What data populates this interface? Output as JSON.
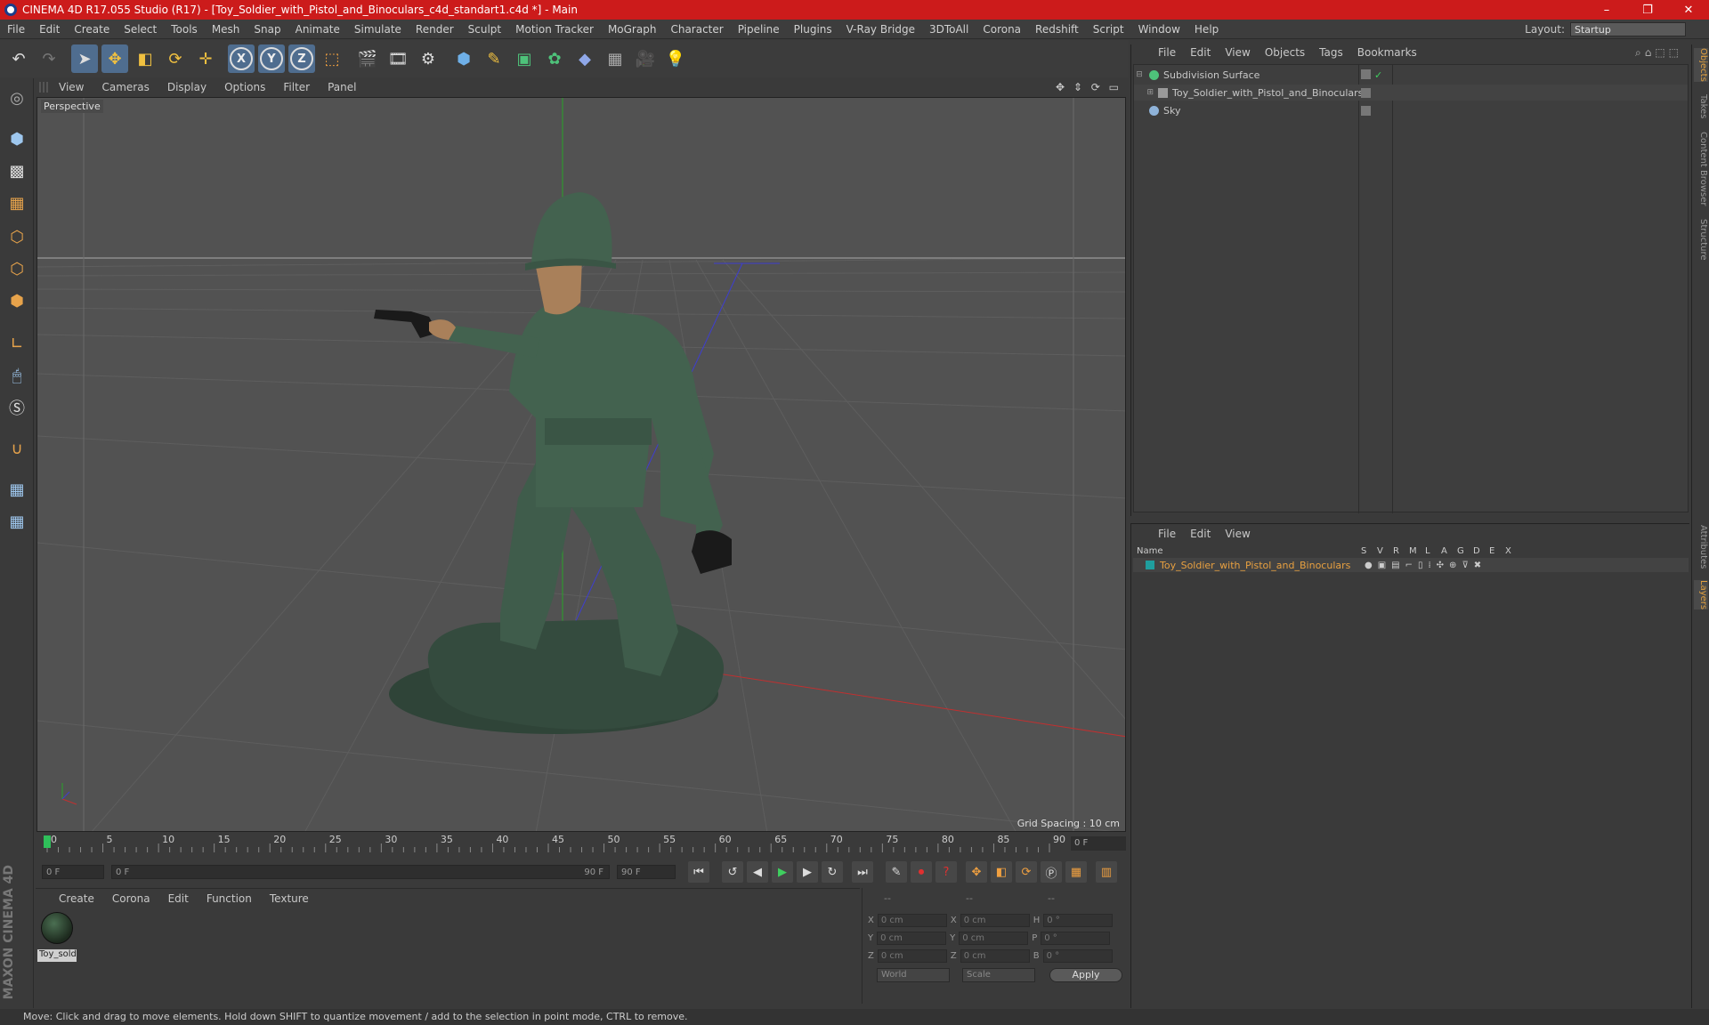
{
  "title": "CINEMA 4D R17.055 Studio (R17) - [Toy_Soldier_with_Pistol_and_Binoculars_c4d_standart1.c4d *] - Main",
  "window_controls": {
    "minimize": "–",
    "maximize": "❐",
    "close": "✕"
  },
  "menu": [
    "File",
    "Edit",
    "Create",
    "Select",
    "Tools",
    "Mesh",
    "Snap",
    "Animate",
    "Simulate",
    "Render",
    "Sculpt",
    "Motion Tracker",
    "MoGraph",
    "Character",
    "Pipeline",
    "Plugins",
    "V-Ray Bridge",
    "3DToAll",
    "Corona",
    "Redshift",
    "Script",
    "Window",
    "Help"
  ],
  "layout": {
    "label": "Layout:",
    "value": "Startup"
  },
  "viewport": {
    "menu": [
      "View",
      "Cameras",
      "Display",
      "Options",
      "Filter",
      "Panel"
    ],
    "nav_icons": "✥ ⇕ ⟳ ▭",
    "label": "Perspective",
    "grid_spacing": "Grid Spacing : 10 cm"
  },
  "timeline": {
    "ticks": [
      "0",
      "5",
      "10",
      "15",
      "20",
      "25",
      "30",
      "35",
      "40",
      "45",
      "50",
      "55",
      "60",
      "65",
      "70",
      "75",
      "80",
      "85",
      "90"
    ],
    "current_frame": "0 F"
  },
  "transport": {
    "start": "0 F",
    "range_start": "0 F",
    "range_end": "90 F",
    "end": "90 F"
  },
  "material_panel": {
    "menu": [
      "Create",
      "Corona",
      "Edit",
      "Function",
      "Texture"
    ],
    "material_name": "Toy_sold"
  },
  "coords": {
    "header": [
      "--",
      "--",
      "--"
    ],
    "rows": [
      {
        "a": "X",
        "v1": "0 cm",
        "b": "X",
        "v2": "0 cm",
        "c": "H",
        "v3": "0 °"
      },
      {
        "a": "Y",
        "v1": "0 cm",
        "b": "Y",
        "v2": "0 cm",
        "c": "P",
        "v3": "0 °"
      },
      {
        "a": "Z",
        "v1": "0 cm",
        "b": "Z",
        "v2": "0 cm",
        "c": "B",
        "v3": "0 °"
      }
    ],
    "mode": "World",
    "scale": "Scale",
    "apply": "Apply"
  },
  "object_manager": {
    "menu": [
      "File",
      "Edit",
      "View",
      "Objects",
      "Tags",
      "Bookmarks"
    ],
    "objects": [
      {
        "name": "Subdivision Surface",
        "icon_color": "#4ec27a"
      },
      {
        "name": "Toy_Soldier_with_Pistol_and_Binoculars",
        "icon_color": "#9a9a9a"
      },
      {
        "name": "Sky",
        "icon_color": "#8fb3d9"
      }
    ]
  },
  "layer_manager": {
    "menu": [
      "File",
      "Edit",
      "View"
    ],
    "columns": [
      "Name",
      "S",
      "V",
      "R",
      "M",
      "L",
      "A",
      "G",
      "D",
      "E",
      "X"
    ],
    "layers": [
      {
        "name": "Toy_Soldier_with_Pistol_and_Binoculars",
        "color": "#1f9e9e"
      }
    ]
  },
  "side_tabs": [
    "Objects",
    "Takes",
    "Content Browser",
    "Structure",
    "Attributes",
    "Layers"
  ],
  "status": "Move: Click and drag to move elements. Hold down SHIFT to quantize movement / add to the selection in point mode, CTRL to remove.",
  "branding": "MAXON CINEMA 4D"
}
